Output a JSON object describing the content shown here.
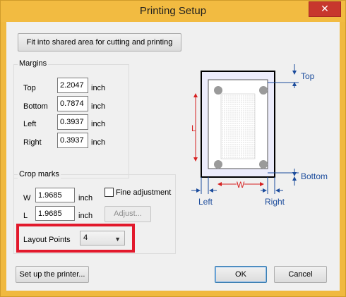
{
  "window": {
    "title": "Printing Setup",
    "close_glyph": "✕"
  },
  "buttons": {
    "fit": "Fit into shared area for cutting and printing",
    "adjust": "Adjust...",
    "setup_printer": "Set up the printer...",
    "ok": "OK",
    "cancel": "Cancel"
  },
  "margins": {
    "group_label": "Margins",
    "unit": "inch",
    "top": {
      "label": "Top",
      "value": "2.2047"
    },
    "bottom": {
      "label": "Bottom",
      "value": "0.7874"
    },
    "left": {
      "label": "Left",
      "value": "0.3937"
    },
    "right": {
      "label": "Right",
      "value": "0.3937"
    }
  },
  "crop_marks": {
    "group_label": "Crop marks",
    "unit": "inch",
    "w": {
      "label": "W",
      "value": "1.9685"
    },
    "l": {
      "label": "L",
      "value": "1.9685"
    },
    "fine_adjustment_label": "Fine adjustment",
    "fine_adjustment_checked": false,
    "layout_points_label": "Layout Points",
    "layout_points_value": "4"
  },
  "diagram": {
    "top": "Top",
    "bottom": "Bottom",
    "left": "Left",
    "right": "Right",
    "w": "W",
    "l": "L"
  },
  "colors": {
    "title_bar": "#f2bb41",
    "highlight": "#e2192c",
    "diagram_blue": "#1c4c9c",
    "diagram_red": "#d62020"
  }
}
